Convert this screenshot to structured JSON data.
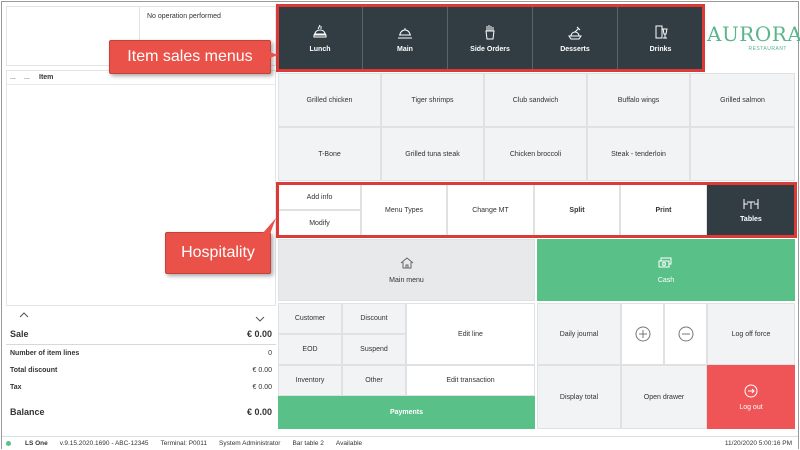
{
  "receipt": {
    "message": "No operation performed",
    "col_dots1": "...",
    "col_dots2": "...",
    "col_item": "Item"
  },
  "totals": {
    "sale_label": "Sale",
    "sale_value": "€ 0.00",
    "lines_label": "Number of item lines",
    "lines_value": "0",
    "discount_label": "Total discount",
    "discount_value": "€ 0.00",
    "tax_label": "Tax",
    "tax_value": "€ 0.00",
    "balance_label": "Balance",
    "balance_value": "€ 0.00"
  },
  "menus": [
    {
      "label": "Lunch",
      "icon": "lunch-icon"
    },
    {
      "label": "Main",
      "icon": "main-dish-icon"
    },
    {
      "label": "Side Orders",
      "icon": "fries-icon"
    },
    {
      "label": "Desserts",
      "icon": "dessert-icon"
    },
    {
      "label": "Drinks",
      "icon": "drinks-icon"
    }
  ],
  "logo": {
    "name": "AURORA",
    "sub": "RESTAURANT"
  },
  "items": [
    "Grilled chicken",
    "Tiger shrimps",
    "Club sandwich",
    "Buffalo wings",
    "Grilled salmon",
    "T-Bone",
    "Grilled tuna steak",
    "Chicken broccoli",
    "Steak - tenderloin",
    ""
  ],
  "hospitality": {
    "add_info": "Add info",
    "modify": "Modify",
    "menu_types": "Menu Types",
    "change_mt": "Change MT",
    "split": "Split",
    "print": "Print",
    "tables": "Tables"
  },
  "actions": {
    "main_menu": "Main menu",
    "cash": "Cash",
    "customer": "Customer",
    "discount": "Discount",
    "edit_line": "Edit line",
    "eod": "EOD",
    "suspend": "Suspend",
    "inventory": "Inventory",
    "other": "Other",
    "edit_transaction": "Edit transaction",
    "payments": "Payments",
    "daily_journal": "Daily journal",
    "log_off_force": "Log off force",
    "display_total": "Display total",
    "open_drawer": "Open drawer",
    "log_out": "Log out"
  },
  "callouts": {
    "item_sales_menus": "Item sales menus",
    "hospitality": "Hospitality"
  },
  "status": {
    "brand": "LS One",
    "version": "v.9.15.2020.1690 - ABC-12345",
    "terminal": "Terminal: P0011",
    "user": "System Administrator",
    "table": "Bar table 2",
    "availability": "Available",
    "datetime": "11/20/2020 5:00:16 PM"
  },
  "colors": {
    "dark": "#323d43",
    "green": "#59c088",
    "red": "#ef5556",
    "logo_green": "#5ab48c",
    "callout": "#ea5148"
  }
}
